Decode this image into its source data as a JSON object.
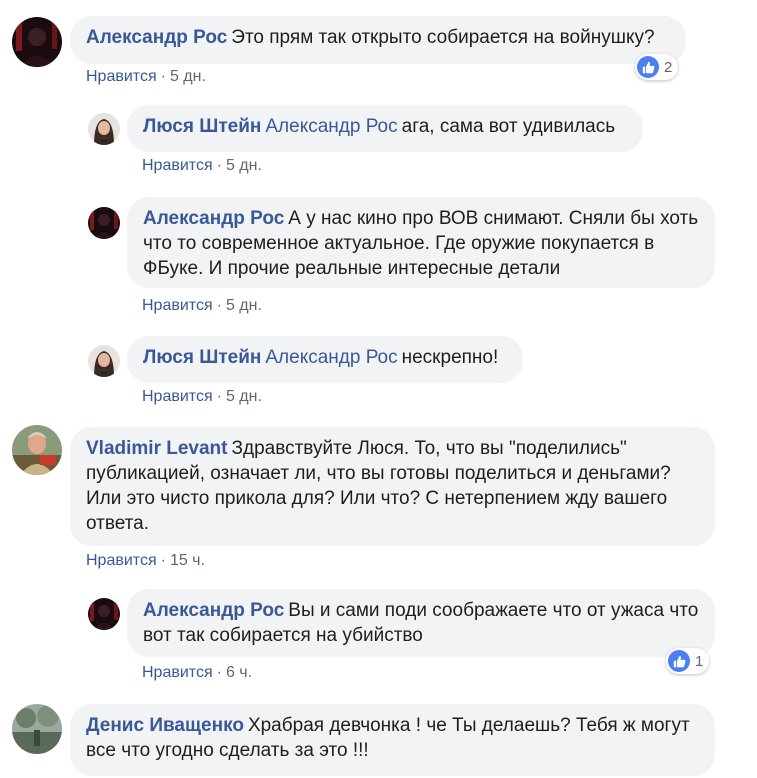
{
  "comments": [
    {
      "author": "Александр Рос",
      "mention": "",
      "text": "Это прям так открыто собирается на войнушку?",
      "like_label": "Нравится",
      "time": "5 дн.",
      "reaction_count": "2"
    },
    {
      "author": "Люся Штейн",
      "mention": "Александр Рос",
      "text": "ага, сама вот удивилась",
      "like_label": "Нравится",
      "time": "5 дн."
    },
    {
      "author": "Александр Рос",
      "mention": "",
      "text": "А у нас кино про ВОВ снимают. Сняли бы хоть что то современное актуальное. Где оружие покупается в ФБуке. И прочие реальные интересные детали",
      "like_label": "Нравится",
      "time": "5 дн."
    },
    {
      "author": "Люся Штейн",
      "mention": "Александр Рос",
      "text": "нескрепно!",
      "like_label": "Нравится",
      "time": "5 дн."
    },
    {
      "author": "Vladimir Levant",
      "mention": "",
      "text": "Здравствуйте Люся. То, что вы \"поделились\" публикацией, означает ли, что вы готовы поделиться и деньгами? Или это чисто прикола для? Или что? С нетерпением жду вашего ответа.",
      "like_label": "Нравится",
      "time": "15 ч."
    },
    {
      "author": "Александр Рос",
      "mention": "",
      "text": "Вы и сами поди соображаете что от ужаса что вот так собирается на убийство",
      "like_label": "Нравится",
      "time": "6 ч.",
      "reaction_count": "1"
    },
    {
      "author": "Денис Иващенко",
      "mention": "",
      "text": "Храбрая девчонка ! че Ты делаешь? Тебя ж могут все что угодно сделать за это !!!",
      "like_label": "",
      "time": ""
    }
  ],
  "colors": {
    "link": "#385898",
    "bubble": "#f2f3f5",
    "meta": "#606770",
    "like_badge": "#4b7ff2"
  },
  "icons": {
    "reaction": "thumbs-up-icon"
  }
}
